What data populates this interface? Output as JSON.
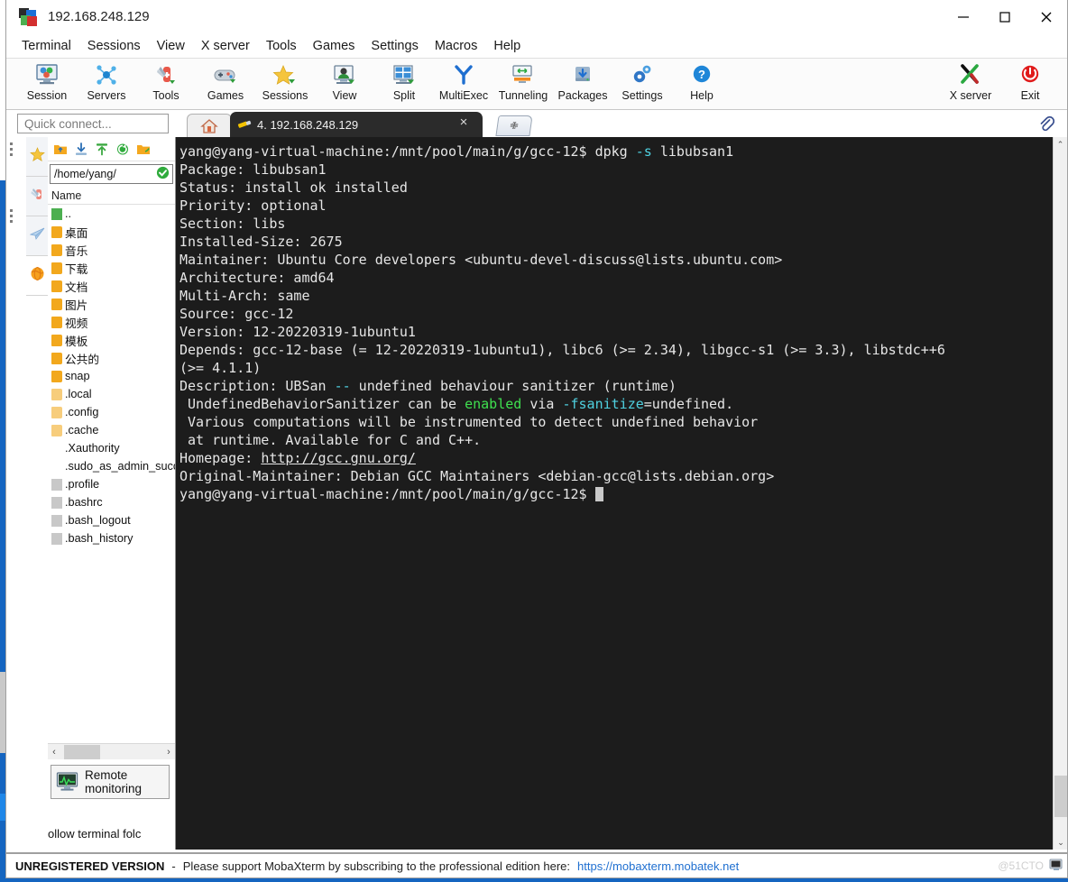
{
  "window": {
    "title": "192.168.248.129",
    "app_icon": "mobaxterm-logo-icon",
    "minimize_label": "Minimize",
    "maximize_label": "Maximize",
    "close_label": "Close"
  },
  "menubar": {
    "items": [
      "Terminal",
      "Sessions",
      "View",
      "X server",
      "Tools",
      "Games",
      "Settings",
      "Macros",
      "Help"
    ]
  },
  "toolbar": {
    "left_buttons": [
      {
        "label": "Session",
        "icon": "session-icon"
      },
      {
        "label": "Servers",
        "icon": "servers-icon"
      },
      {
        "label": "Tools",
        "icon": "tools-icon"
      },
      {
        "label": "Games",
        "icon": "games-icon"
      },
      {
        "label": "Sessions",
        "icon": "sessions-star-icon"
      },
      {
        "label": "View",
        "icon": "view-icon"
      },
      {
        "label": "Split",
        "icon": "split-icon"
      },
      {
        "label": "MultiExec",
        "icon": "multiexec-icon"
      },
      {
        "label": "Tunneling",
        "icon": "tunneling-icon"
      },
      {
        "label": "Packages",
        "icon": "packages-icon"
      },
      {
        "label": "Settings",
        "icon": "settings-gear-icon"
      },
      {
        "label": "Help",
        "icon": "help-question-icon"
      }
    ],
    "right_buttons": [
      {
        "label": "X server",
        "icon": "x-server-icon"
      },
      {
        "label": "Exit",
        "icon": "power-exit-icon"
      }
    ]
  },
  "quick_connect": {
    "placeholder": "Quick connect...",
    "value": ""
  },
  "tabs": {
    "home_tab_icon": "home-icon",
    "active": {
      "label": "4. 192.168.248.129",
      "icon": "terminal-plug-icon",
      "close_glyph": "×"
    },
    "new_tab_glyph": "✙",
    "clip_icon": "paperclip-icon"
  },
  "sidebar": {
    "vtabs": [
      {
        "name": "sessions-star",
        "icon": "star-icon"
      },
      {
        "name": "tools-knife",
        "icon": "swiss-knife-icon"
      },
      {
        "name": "macros-plane",
        "icon": "paper-plane-icon"
      },
      {
        "name": "sftp-globe",
        "icon": "globe-icon"
      }
    ]
  },
  "file_browser": {
    "toolbar_icons": [
      "folder-up-icon",
      "download-icon",
      "upload-icon",
      "refresh-icon",
      "new-folder-icon"
    ],
    "path": "/home/yang/",
    "path_status_icon": "check-circle-icon",
    "column_header": "Name",
    "items": [
      {
        "name": "..",
        "kind": "up"
      },
      {
        "name": "桌面",
        "kind": "folder"
      },
      {
        "name": "音乐",
        "kind": "folder"
      },
      {
        "name": "下载",
        "kind": "folder"
      },
      {
        "name": "文档",
        "kind": "folder"
      },
      {
        "name": "图片",
        "kind": "folder"
      },
      {
        "name": "视频",
        "kind": "folder"
      },
      {
        "name": "模板",
        "kind": "folder"
      },
      {
        "name": "公共的",
        "kind": "folder"
      },
      {
        "name": "snap",
        "kind": "folder"
      },
      {
        "name": ".local",
        "kind": "folder-hidden"
      },
      {
        "name": ".config",
        "kind": "folder-hidden"
      },
      {
        "name": ".cache",
        "kind": "folder-hidden"
      },
      {
        "name": ".Xauthority",
        "kind": "file"
      },
      {
        "name": ".sudo_as_admin_succ",
        "kind": "file"
      },
      {
        "name": ".profile",
        "kind": "file"
      },
      {
        "name": ".bashrc",
        "kind": "file"
      },
      {
        "name": ".bash_logout",
        "kind": "file"
      },
      {
        "name": ".bash_history",
        "kind": "file"
      }
    ],
    "hscroll": {
      "left_glyph": "‹",
      "right_glyph": "›"
    },
    "remote_monitoring_label": "Remote monitoring",
    "remote_monitoring_icon": "monitor-graph-icon",
    "follow_terminal_label": "ollow terminal folc"
  },
  "terminal": {
    "prompt": "yang@yang-virtual-machine:/mnt/pool/main/g/gcc-12$",
    "lines": [
      {
        "segments": [
          {
            "t": "yang@yang-virtual-machine:/mnt/pool/main/g/gcc-12$ dpkg ",
            "c": "white"
          },
          {
            "t": "-s",
            "c": "cyan"
          },
          {
            "t": " libubsan1",
            "c": "white"
          }
        ]
      },
      {
        "segments": [
          {
            "t": "Package: libubsan1",
            "c": "white"
          }
        ]
      },
      {
        "segments": [
          {
            "t": "Status: install ok installed",
            "c": "white"
          }
        ]
      },
      {
        "segments": [
          {
            "t": "Priority: optional",
            "c": "white"
          }
        ]
      },
      {
        "segments": [
          {
            "t": "Section: libs",
            "c": "white"
          }
        ]
      },
      {
        "segments": [
          {
            "t": "Installed-Size: 2675",
            "c": "white"
          }
        ]
      },
      {
        "segments": [
          {
            "t": "Maintainer: Ubuntu Core developers <ubuntu-devel-discuss@lists.ubuntu.com>",
            "c": "white"
          }
        ]
      },
      {
        "segments": [
          {
            "t": "Architecture: amd64",
            "c": "white"
          }
        ]
      },
      {
        "segments": [
          {
            "t": "Multi-Arch: same",
            "c": "white"
          }
        ]
      },
      {
        "segments": [
          {
            "t": "Source: gcc-12",
            "c": "white"
          }
        ]
      },
      {
        "segments": [
          {
            "t": "Version: 12-20220319-1ubuntu1",
            "c": "white"
          }
        ]
      },
      {
        "segments": [
          {
            "t": "Depends: gcc-12-base (= 12-20220319-1ubuntu1), libc6 (>= 2.34), libgcc-s1 (>= 3.3), libstdc++6",
            "c": "white"
          }
        ]
      },
      {
        "segments": [
          {
            "t": "(>= 4.1.1)",
            "c": "white"
          }
        ]
      },
      {
        "segments": [
          {
            "t": "Description: UBSan ",
            "c": "white"
          },
          {
            "t": "--",
            "c": "cyan"
          },
          {
            "t": " undefined behaviour sanitizer (runtime)",
            "c": "white"
          }
        ]
      },
      {
        "segments": [
          {
            "t": " UndefinedBehaviorSanitizer can be ",
            "c": "white"
          },
          {
            "t": "enabled",
            "c": "green"
          },
          {
            "t": " via ",
            "c": "white"
          },
          {
            "t": "-fsanitize",
            "c": "cyan"
          },
          {
            "t": "=undefined.",
            "c": "white"
          }
        ]
      },
      {
        "segments": [
          {
            "t": " Various computations will be instrumented to detect undefined behavior",
            "c": "white"
          }
        ]
      },
      {
        "segments": [
          {
            "t": " at runtime. Available for C and C++.",
            "c": "white"
          }
        ]
      },
      {
        "segments": [
          {
            "t": "Homepage: ",
            "c": "white"
          },
          {
            "t": "http://gcc.gnu.org/",
            "c": "link"
          }
        ]
      },
      {
        "segments": [
          {
            "t": "Original-Maintainer: Debian GCC Maintainers <debian-gcc@lists.debian.org>",
            "c": "white"
          }
        ]
      },
      {
        "segments": [
          {
            "t": "yang@yang-virtual-machine:/mnt/pool/main/g/gcc-12$ ",
            "c": "white"
          },
          {
            "t": "",
            "c": "cursor"
          }
        ]
      }
    ],
    "scrollbar": {
      "up_glyph": "⌃",
      "down_glyph": "⌄"
    }
  },
  "statusbar": {
    "bold_text": "UNREGISTERED VERSION",
    "dash": "-",
    "message": "Please support MobaXterm by subscribing to the professional edition here:",
    "link": "https://mobaxterm.mobatek.net",
    "watermark": "@51CTO",
    "tray_icon": "moba-tray-icon"
  },
  "colors": {
    "accent_blue": "#1565c0",
    "terminal_bg": "#1c1c1c",
    "terminal_fg": "#e6e6e6",
    "cyan": "#4fd1e0",
    "green": "#3fe04f",
    "link_blue": "#1f6fd0",
    "folder_orange": "#f2a81d"
  }
}
